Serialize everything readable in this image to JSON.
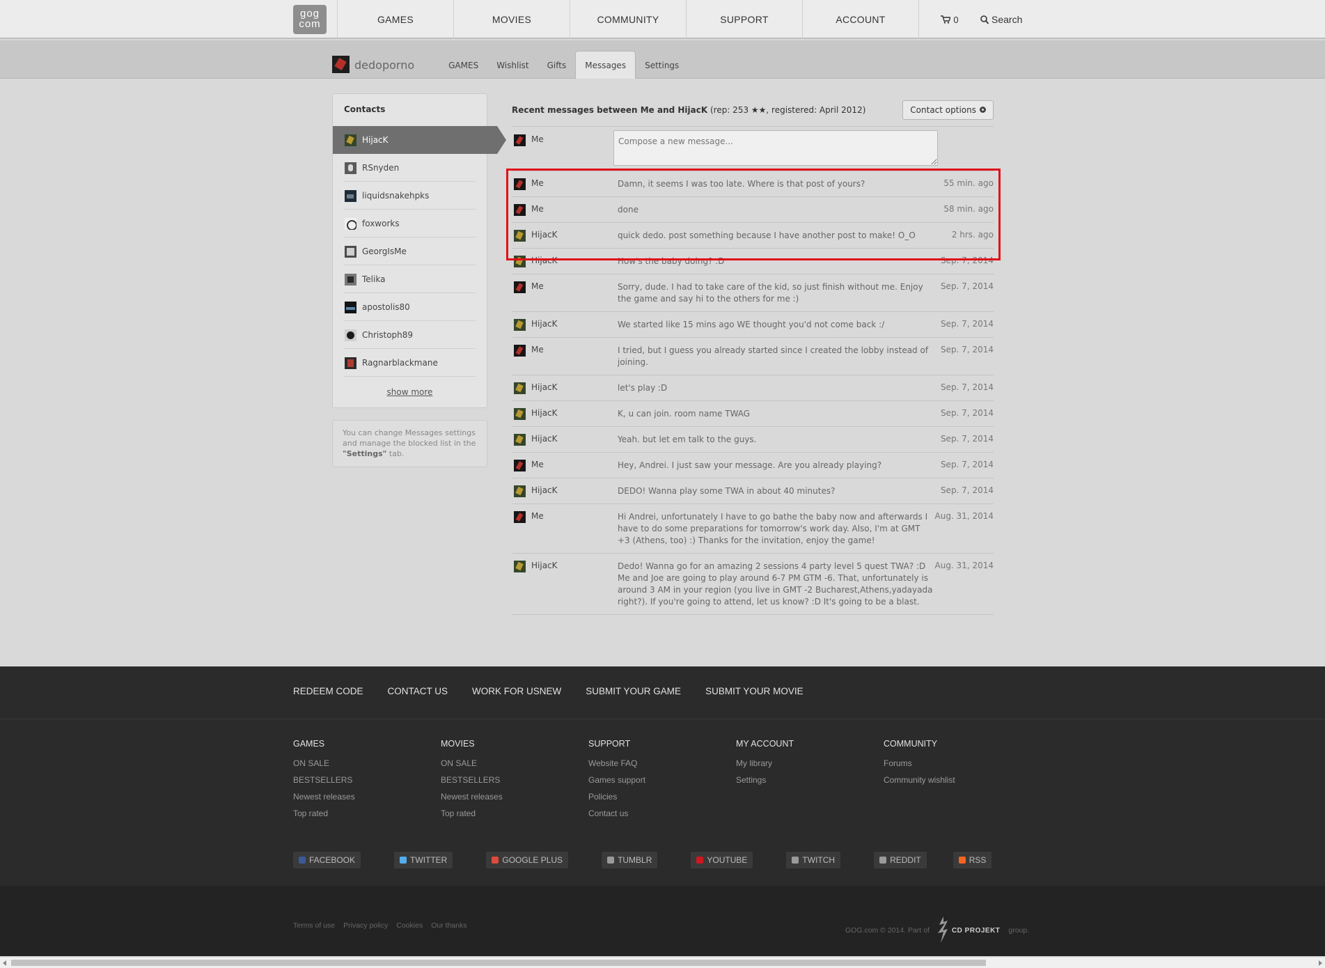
{
  "topnav": {
    "logo_line1": "gog",
    "logo_line2": "com",
    "items": [
      "GAMES",
      "MOVIES",
      "COMMUNITY",
      "SUPPORT",
      "ACCOUNT"
    ],
    "cart_count": "0",
    "search_label": "Search"
  },
  "subnav": {
    "username": "dedoporno",
    "tabs": [
      "GAMES",
      "Wishlist",
      "Gifts",
      "Messages",
      "Settings"
    ],
    "active_tab": "Messages"
  },
  "contacts": {
    "title": "Contacts",
    "items": [
      "HijacK",
      "RSnyden",
      "liquidsnakehpks",
      "foxworks",
      "GeorgIsMe",
      "Telika",
      "apostolis80",
      "Christoph89",
      "Ragnarblackmane"
    ],
    "active": "HijacK",
    "show_more": "show more"
  },
  "note": {
    "text_before": "You can change Messages settings and manage the blocked list in the ",
    "settings_word": "\"Settings\"",
    "text_after": " tab."
  },
  "conversation": {
    "title_bold": "Recent messages between Me and HijacK",
    "title_rep": " (rep: 253 ",
    "stars": "★★",
    "title_registered": ", registered: April 2012)",
    "contact_options": "Contact options",
    "compose_author": "Me",
    "compose_placeholder": "Compose a new message..."
  },
  "messages": [
    {
      "author": "Me",
      "text": "Damn, it seems I was too late. Where is that post of yours?",
      "time": "55 min. ago"
    },
    {
      "author": "Me",
      "text": "done",
      "time": "58 min. ago"
    },
    {
      "author": "HijacK",
      "text": "quick dedo. post something because I have another post to make! O_O",
      "time": "2 hrs. ago"
    },
    {
      "author": "HijacK",
      "text": "How's the baby doing? :D",
      "time": "Sep. 7, 2014"
    },
    {
      "author": "Me",
      "text": "Sorry, dude. I had to take care of the kid, so just finish without me. Enjoy the game and say hi to the others for me :)",
      "time": "Sep. 7, 2014"
    },
    {
      "author": "HijacK",
      "text": "We started like 15 mins ago WE thought you'd not come back :/",
      "time": "Sep. 7, 2014"
    },
    {
      "author": "Me",
      "text": "I tried, but I guess you already started since I created the lobby instead of joining.",
      "time": "Sep. 7, 2014"
    },
    {
      "author": "HijacK",
      "text": "let's play :D",
      "time": "Sep. 7, 2014"
    },
    {
      "author": "HijacK",
      "text": "K, u can join. room name TWAG",
      "time": "Sep. 7, 2014"
    },
    {
      "author": "HijacK",
      "text": "Yeah. but let em talk to the guys.",
      "time": "Sep. 7, 2014"
    },
    {
      "author": "Me",
      "text": "Hey, Andrei. I just saw your message. Are you already playing?",
      "time": "Sep. 7, 2014"
    },
    {
      "author": "HijacK",
      "text": "DEDO! Wanna play some TWA in about 40 minutes?",
      "time": "Sep. 7, 2014"
    },
    {
      "author": "Me",
      "text": "Hi Andrei, unfortunately I have to go bathe the baby now and afterwards I have to do some preparations for tomorrow's work day. Also, I'm at GMT +3 (Athens, too) :) Thanks for the invitation, enjoy the game!",
      "time": "Aug. 31, 2014"
    },
    {
      "author": "HijacK",
      "text": "Dedo! Wanna go for an amazing 2 sessions 4 party level 5 quest TWA? :D Me and Joe are going to play around 6-7 PM GTM -6. That, unfortunately is around 3 AM in your region (you live in GMT -2 Bucharest,Athens,yadayada right?). If you're going to attend, let us know? :D It's going to be a blast.",
      "time": "Aug. 31, 2014"
    }
  ],
  "footer": {
    "top_links": [
      "REDEEM CODE",
      "CONTACT US",
      "WORK FOR USNEW",
      "SUBMIT YOUR GAME",
      "SUBMIT YOUR MOVIE"
    ],
    "columns": [
      {
        "title": "GAMES",
        "items": [
          "ON SALE",
          "BESTSELLERS",
          "Newest releases",
          "Top rated"
        ]
      },
      {
        "title": "MOVIES",
        "items": [
          "ON SALE",
          "BESTSELLERS",
          "Newest releases",
          "Top rated"
        ]
      },
      {
        "title": "SUPPORT",
        "items": [
          "Website FAQ",
          "Games support",
          "Policies",
          "Contact us"
        ]
      },
      {
        "title": "MY ACCOUNT",
        "items": [
          "My library",
          "Settings"
        ]
      },
      {
        "title": "COMMUNITY",
        "items": [
          "Forums",
          "Community wishlist"
        ]
      }
    ],
    "socials": [
      "FACEBOOK",
      "TWITTER",
      "GOOGLE PLUS",
      "TUMBLR",
      "YOUTUBE",
      "TWITCH",
      "REDDIT",
      "RSS"
    ],
    "legal": [
      "Terms of use",
      "Privacy policy",
      "Cookies",
      "Our thanks"
    ],
    "copyright_before": "GOG.com © 2014. Part of",
    "cdp_logo_text": "CD PROJEKT",
    "copyright_after": "group."
  },
  "colors": {
    "highlight": "#e0101a",
    "active_contact": "#6f6f6f",
    "footer_bg": "#2b2b2b"
  }
}
